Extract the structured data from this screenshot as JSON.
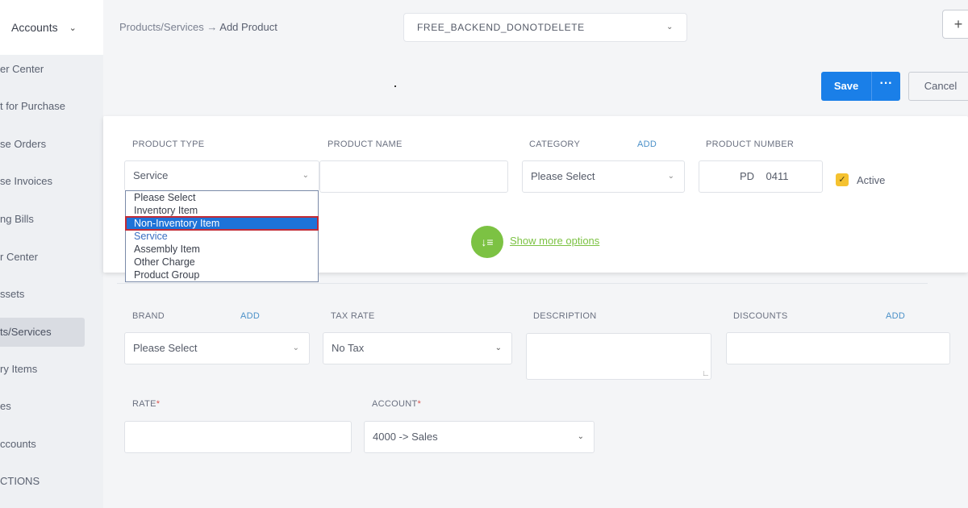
{
  "sidebar": {
    "header_label": "Accounts",
    "items": [
      {
        "label": "er Center"
      },
      {
        "label": "t for Purchase"
      },
      {
        "label": "se Orders"
      },
      {
        "label": "se Invoices"
      },
      {
        "label": "ng Bills"
      },
      {
        "label": "r Center"
      },
      {
        "label": "ssets"
      },
      {
        "label": "ts/Services",
        "active": true
      },
      {
        "label": "ry Items"
      },
      {
        "label": "es"
      },
      {
        "label": "ccounts"
      },
      {
        "label": "CTIONS"
      }
    ]
  },
  "topbar": {
    "breadcrumb_parent": "Products/Services",
    "breadcrumb_sep": " → ",
    "breadcrumb_current": "Add Product",
    "company": "FREE_BACKEND_DONOTDELETE",
    "plus_label": "+"
  },
  "actions": {
    "save_label": "Save",
    "more_label": "···",
    "cancel_label": "Cancel"
  },
  "form": {
    "product_type_label": "PRODUCT TYPE",
    "product_type_value": "Service",
    "product_type_options": [
      "Please Select",
      "Inventory Item",
      "Non-Inventory Item",
      "Service",
      "Assembly Item",
      "Other Charge",
      "Product Group"
    ],
    "product_name_label": "PRODUCT NAME",
    "product_name_value": "",
    "category_label": "CATEGORY",
    "category_add": "ADD",
    "category_value": "Please Select",
    "product_number_label": "PRODUCT NUMBER",
    "product_number_value": "PD    0411",
    "active_label": "Active",
    "show_more_label": "Show more options",
    "brand_label": "BRAND",
    "brand_add": "ADD",
    "brand_value": "Please Select",
    "tax_rate_label": "TAX RATE",
    "tax_rate_value": "No Tax",
    "description_label": "DESCRIPTION",
    "discounts_label": "DISCOUNTS",
    "discounts_add": "ADD",
    "rate_label": "RATE",
    "account_label": "ACCOUNT",
    "account_value": "4000 -> Sales",
    "required_mark": "*"
  },
  "colors": {
    "primary": "#1a7fe8",
    "highlight": "#1e73d8",
    "highlight_outline": "#c22b35",
    "green": "#7cc243",
    "checkbox": "#f5c230"
  }
}
